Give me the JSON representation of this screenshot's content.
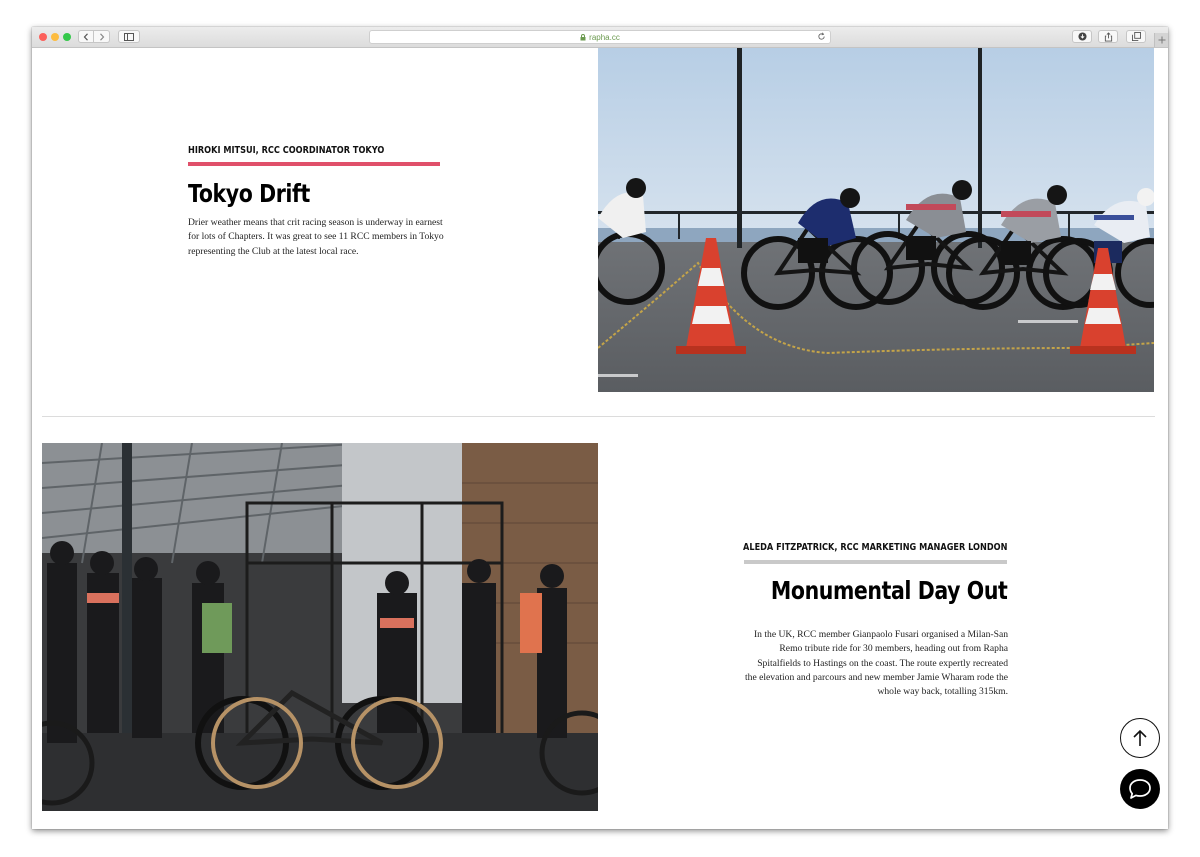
{
  "browser": {
    "url": "rapha.cc",
    "icons": {
      "back": "chevron-left-icon",
      "forward": "chevron-right-icon",
      "sidebar": "sidebar-icon",
      "lock": "lock-icon",
      "reload": "reload-icon",
      "downloads": "download-icon",
      "share": "share-icon",
      "tabs": "tabs-icon",
      "new_tab": "plus-icon"
    }
  },
  "stories": [
    {
      "byline": "HIROKI MITSUI, RCC COORDINATOR TOKYO",
      "title": "Tokyo Drift",
      "body": "Drier weather means that crit racing season is underway in earnest for lots of Chapters. It was great to see 11 RCC members in Tokyo representing the Club at the latest local race.",
      "accent_color": "#e0506a"
    },
    {
      "byline": "ALEDA FITZPATRICK, RCC MARKETING MANAGER LONDON",
      "title": "Monumental Day Out",
      "body": "In the UK, RCC member Gianpaolo Fusari organised a Milan-San Remo tribute ride for 30 members, heading out from Rapha Spitalfields to Hastings on the coast. The route expertly recreated the elevation and parcours and new member Jamie Wharam rode the whole way back, totalling 315km.",
      "accent_color": "#c9c9c9"
    }
  ],
  "floating": {
    "back_to_top_icon": "arrow-up-icon",
    "chat_icon": "chat-bubble-icon"
  }
}
